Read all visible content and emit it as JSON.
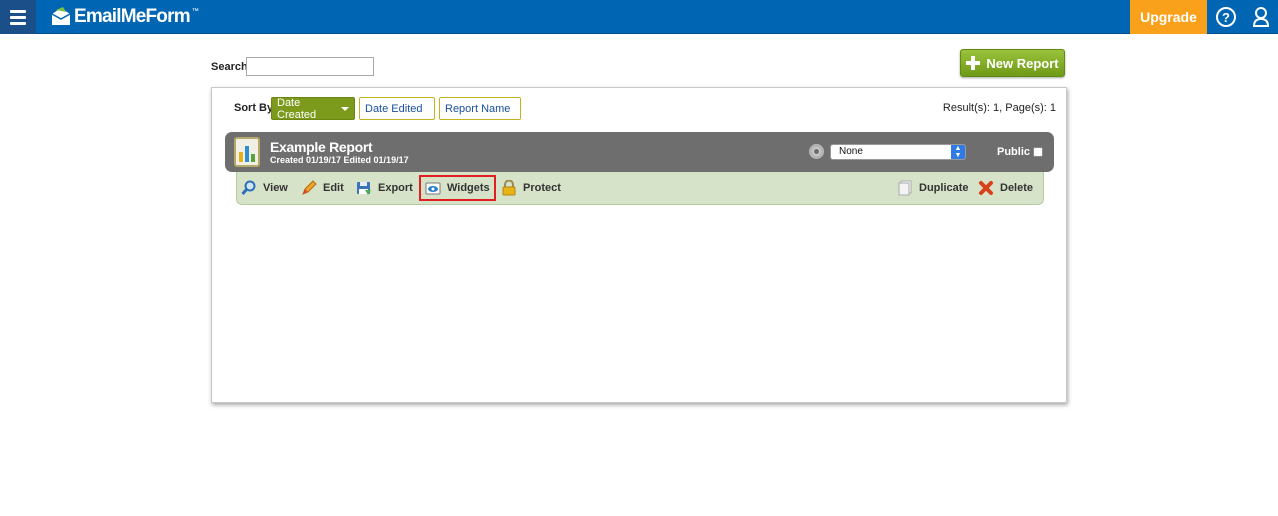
{
  "topbar": {
    "logo_text": "EmailMeForm",
    "logo_tm": "™",
    "upgrade_label": "Upgrade",
    "help_glyph": "?"
  },
  "search": {
    "label": "Search",
    "value": ""
  },
  "new_report_label": "New Report",
  "sort": {
    "label": "Sort By",
    "options": [
      "Date Created",
      "Date Edited",
      "Report Name"
    ],
    "active": "Date Created"
  },
  "results_text": "Result(s): 1, Page(s): 1",
  "report": {
    "title": "Example Report",
    "dates": "Created 01/19/17  Edited 01/19/17",
    "select_value": "None",
    "public_label": "Public",
    "public_checked": false
  },
  "actions": {
    "view": "View",
    "edit": "Edit",
    "export": "Export",
    "widgets": "Widgets",
    "protect": "Protect",
    "duplicate": "Duplicate",
    "delete": "Delete"
  },
  "colors": {
    "topbar": "#0066b3",
    "upgrade": "#f9a11b",
    "new_report": "#7ba824",
    "sort_active": "#7c9a1c",
    "report_header": "#6e6e6e",
    "action_bar": "#d7e3c9",
    "highlight": "#e02020"
  }
}
